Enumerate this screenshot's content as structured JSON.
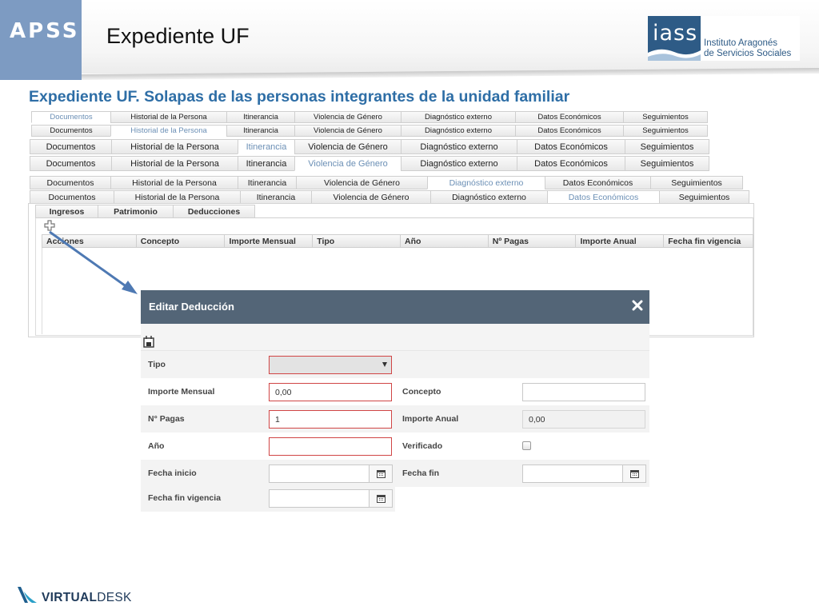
{
  "header": {
    "brand": "APSS",
    "title": "Expediente UF",
    "org_logo": {
      "mark": "iass",
      "name_line1": "Instituto Aragonés",
      "name_line2": "de Servicios Sociales"
    },
    "subtitle": "Expediente UF. Solapas de las personas integrantes de la unidad familiar"
  },
  "tab_rows": [
    {
      "active": 0,
      "tabs": [
        "Documentos",
        "Historial de la Persona",
        "Itinerancia",
        "Violencia de Género",
        "Diagnóstico externo",
        "Datos Económicos",
        "Seguimientos"
      ]
    },
    {
      "active": 1,
      "tabs": [
        "Documentos",
        "Historial de la Persona",
        "Itinerancia",
        "Violencia de Género",
        "Diagnóstico externo",
        "Datos Económicos",
        "Seguimientos"
      ]
    },
    {
      "active": 2,
      "tabs": [
        "Documentos",
        "Historial de la Persona",
        "Itinerancia",
        "Violencia de Género",
        "Diagnóstico externo",
        "Datos Económicos",
        "Seguimientos"
      ]
    },
    {
      "active": 3,
      "tabs": [
        "Documentos",
        "Historial de la Persona",
        "Itinerancia",
        "Violencia de Género",
        "Diagnóstico externo",
        "Datos Económicos",
        "Seguimientos"
      ]
    },
    {
      "active": 4,
      "tabs": [
        "Documentos",
        "Historial de la Persona",
        "Itinerancia",
        "Violencia de Género",
        "Diagnóstico externo",
        "Datos Económicos",
        "Seguimientos"
      ]
    },
    {
      "active": 5,
      "tabs": [
        "Documentos",
        "Historial de la Persona",
        "Itinerancia",
        "Violencia de Género",
        "Diagnóstico externo",
        "Datos Económicos",
        "Seguimientos"
      ]
    }
  ],
  "sub_tabs": {
    "active": 2,
    "tabs": [
      "Ingresos",
      "Patrimonio",
      "Deducciones"
    ]
  },
  "toolbar_icons": {
    "add": "plus-icon",
    "save": "save-icon",
    "close": "close-icon",
    "calendar": "calendar-icon"
  },
  "grid": {
    "columns": [
      "Acciones",
      "Concepto",
      "Importe Mensual",
      "Tipo",
      "Año",
      "Nº Pagas",
      "Importe Anual",
      "Fecha fin vigencia"
    ]
  },
  "dialog": {
    "title": "Editar Deducción",
    "header_color": "#536577",
    "fields": {
      "tipo": {
        "label": "Tipo",
        "value": ""
      },
      "importe_mensual": {
        "label": "Importe Mensual",
        "value": "0,00"
      },
      "concepto": {
        "label": "Concepto",
        "value": ""
      },
      "n_pagas": {
        "label": "N° Pagas",
        "value": "1"
      },
      "importe_anual": {
        "label": "Importe Anual",
        "value": "0,00"
      },
      "anio": {
        "label": "Año",
        "value": ""
      },
      "verificado": {
        "label": "Verificado",
        "checked": false
      },
      "fecha_inicio": {
        "label": "Fecha inicio",
        "value": ""
      },
      "fecha_fin": {
        "label": "Fecha fin",
        "value": ""
      },
      "fecha_fin_vigencia": {
        "label": "Fecha fin vigencia",
        "value": ""
      }
    }
  },
  "footer": {
    "brand_bold": "VIRTUAL",
    "brand_rest": "DESK"
  },
  "colors": {
    "accent": "#2e6ea6",
    "apss_tab": "#7d9bc2",
    "required_border": "#d04545",
    "active_tab_text": "#6b8fb5"
  }
}
